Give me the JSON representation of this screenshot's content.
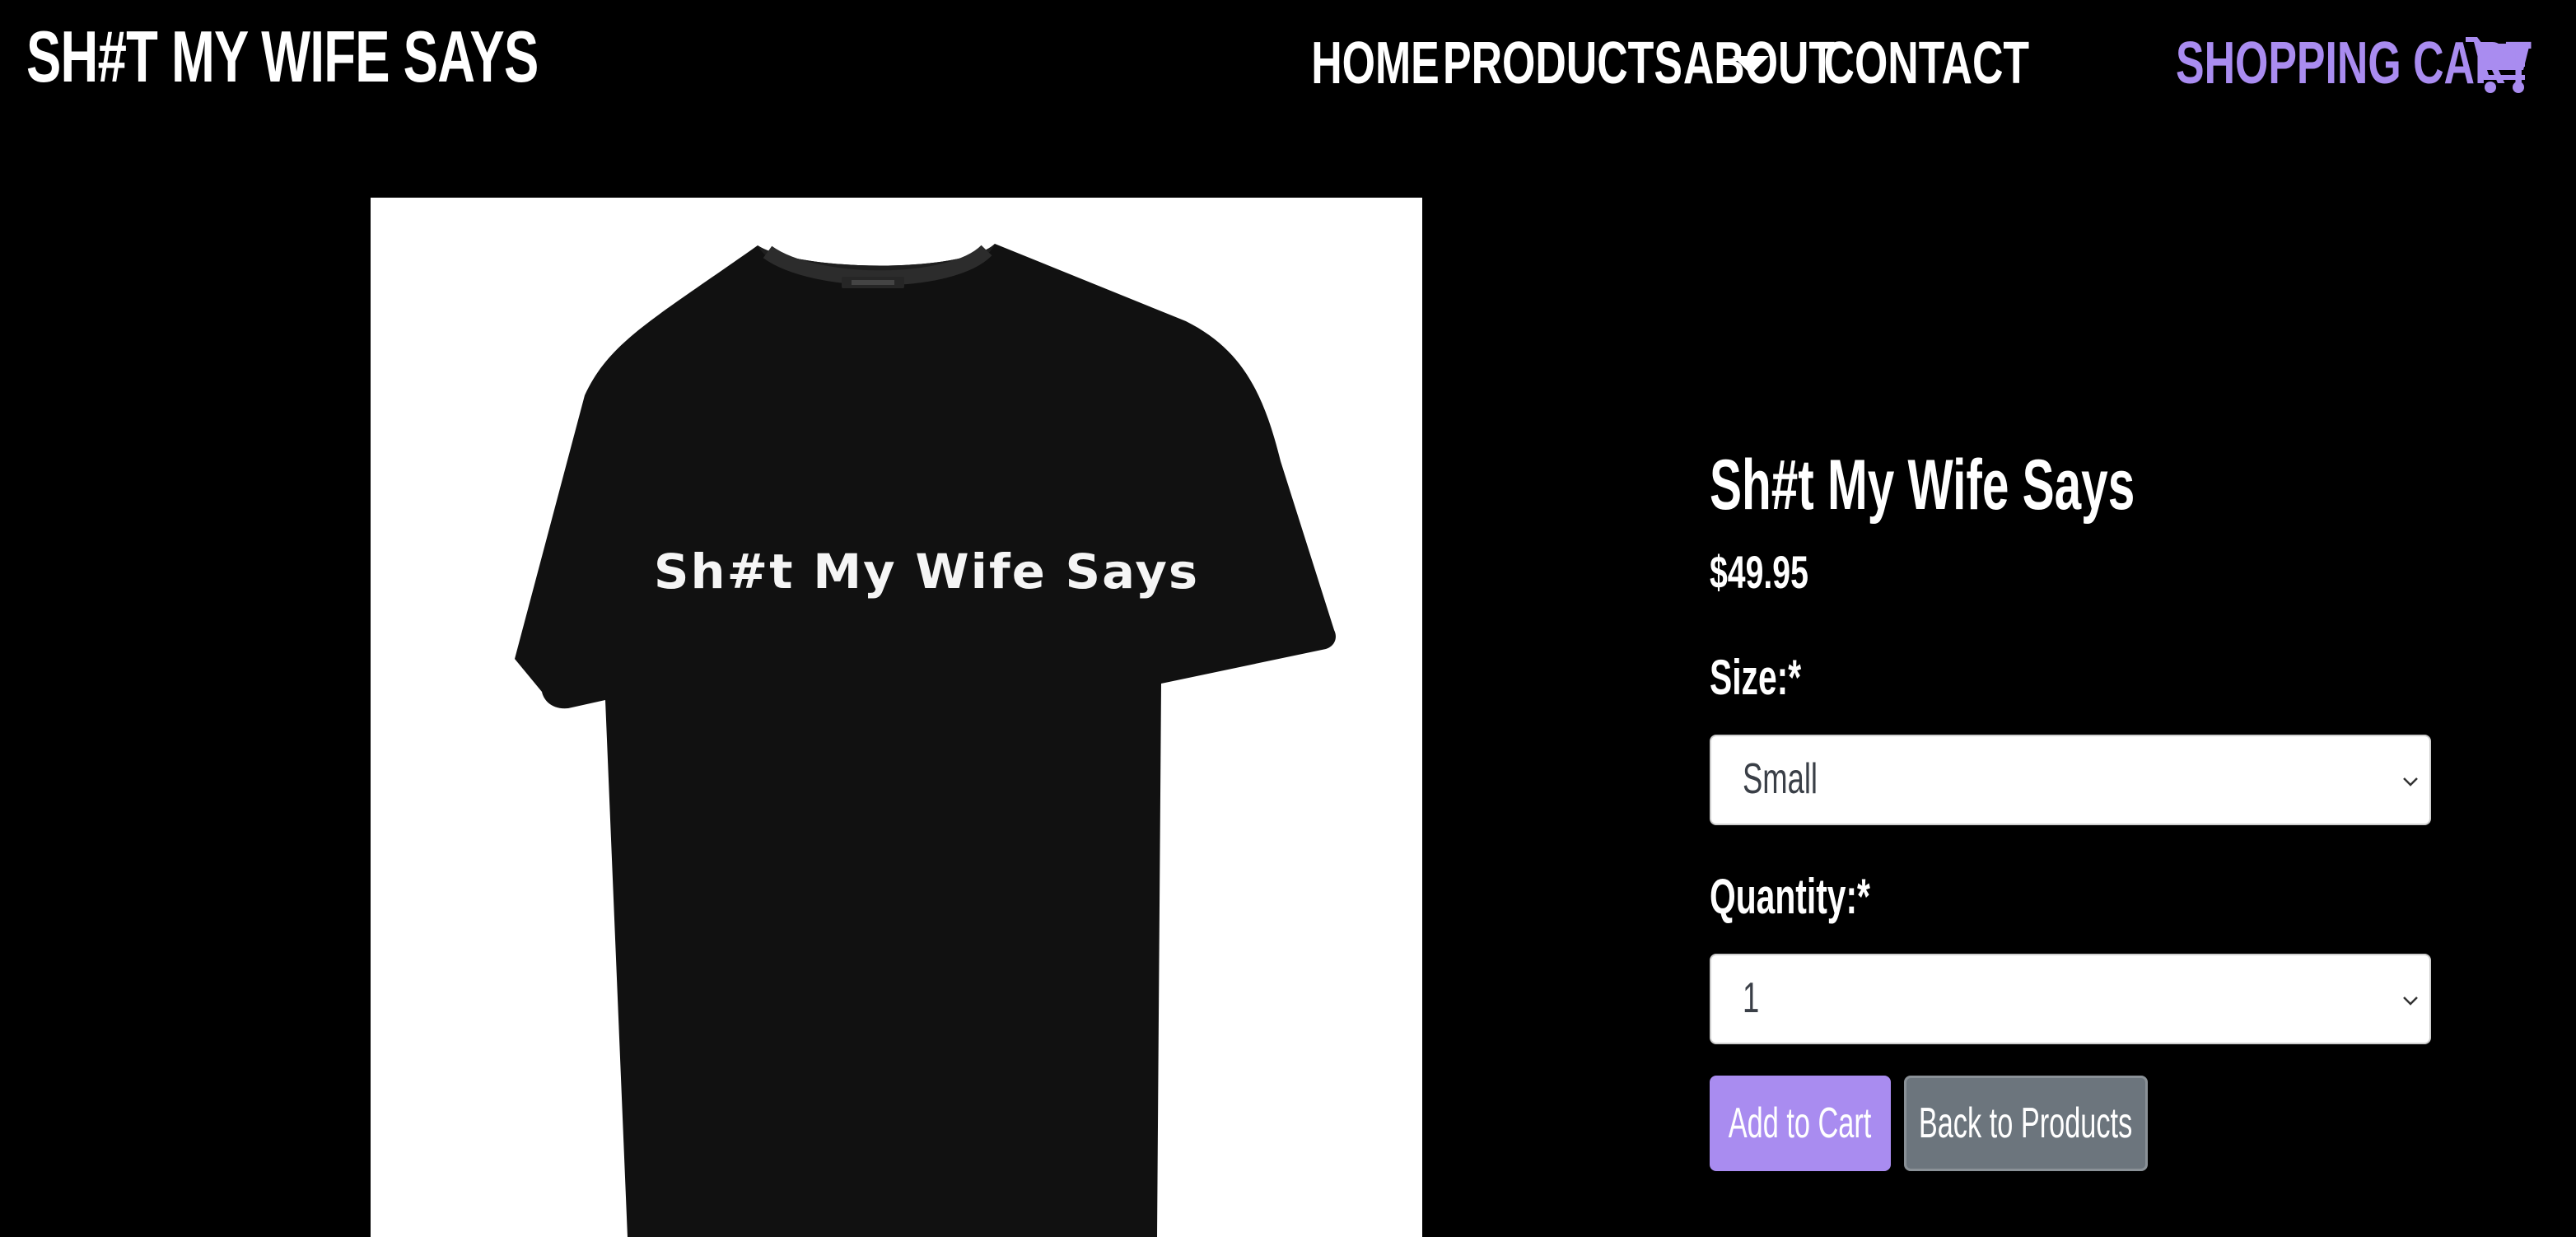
{
  "brand": "SH#T MY WIFE SAYS",
  "nav": {
    "home": "HOME",
    "products": "PRODUCTS",
    "about": "ABOUT",
    "contact": "CONTACT",
    "cart": "SHOPPING CART"
  },
  "product": {
    "image_print": "Sh#t My Wife Says",
    "title": "Sh#t My Wife Says",
    "price": "$49.95",
    "size_label": "Size:*",
    "size_value": "Small",
    "quantity_label": "Quantity:*",
    "quantity_value": "1"
  },
  "actions": {
    "add_to_cart": "Add to Cart",
    "back_to_products": "Back to Products"
  },
  "colors": {
    "background": "#000000",
    "accent": "#a98cf0",
    "secondary_button": "#6c757d"
  },
  "icons": {
    "cart": "shopping-cart-icon",
    "dropdown": "chevron-down-icon"
  }
}
